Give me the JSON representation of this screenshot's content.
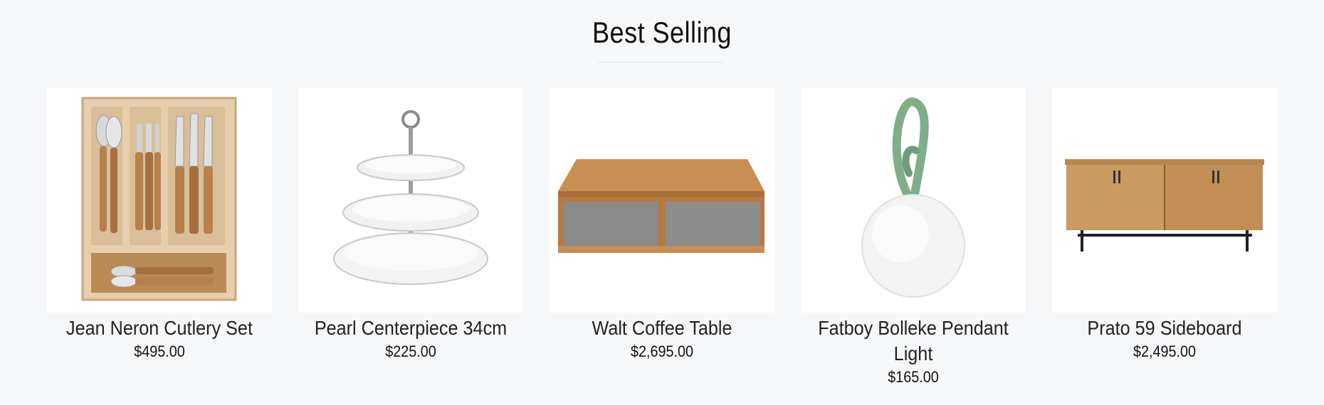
{
  "section": {
    "title": "Best Selling"
  },
  "products": [
    {
      "name": "Jean Neron Cutlery Set",
      "price": "$495.00",
      "image_icon": "cutlery-set-image"
    },
    {
      "name": "Pearl Centerpiece 34cm",
      "price": "$225.00",
      "image_icon": "cake-stand-image"
    },
    {
      "name": "Walt Coffee Table",
      "price": "$2,695.00",
      "image_icon": "coffee-table-image"
    },
    {
      "name": "Fatboy Bolleke Pendant Light",
      "price": "$165.00",
      "image_icon": "pendant-light-image"
    },
    {
      "name": "Prato 59 Sideboard",
      "price": "$2,495.00",
      "image_icon": "sideboard-image"
    }
  ],
  "colors": {
    "background": "#f6f7f9",
    "card_background": "#ffffff",
    "wood": "#c88d52",
    "light_green": "#7fae88"
  }
}
